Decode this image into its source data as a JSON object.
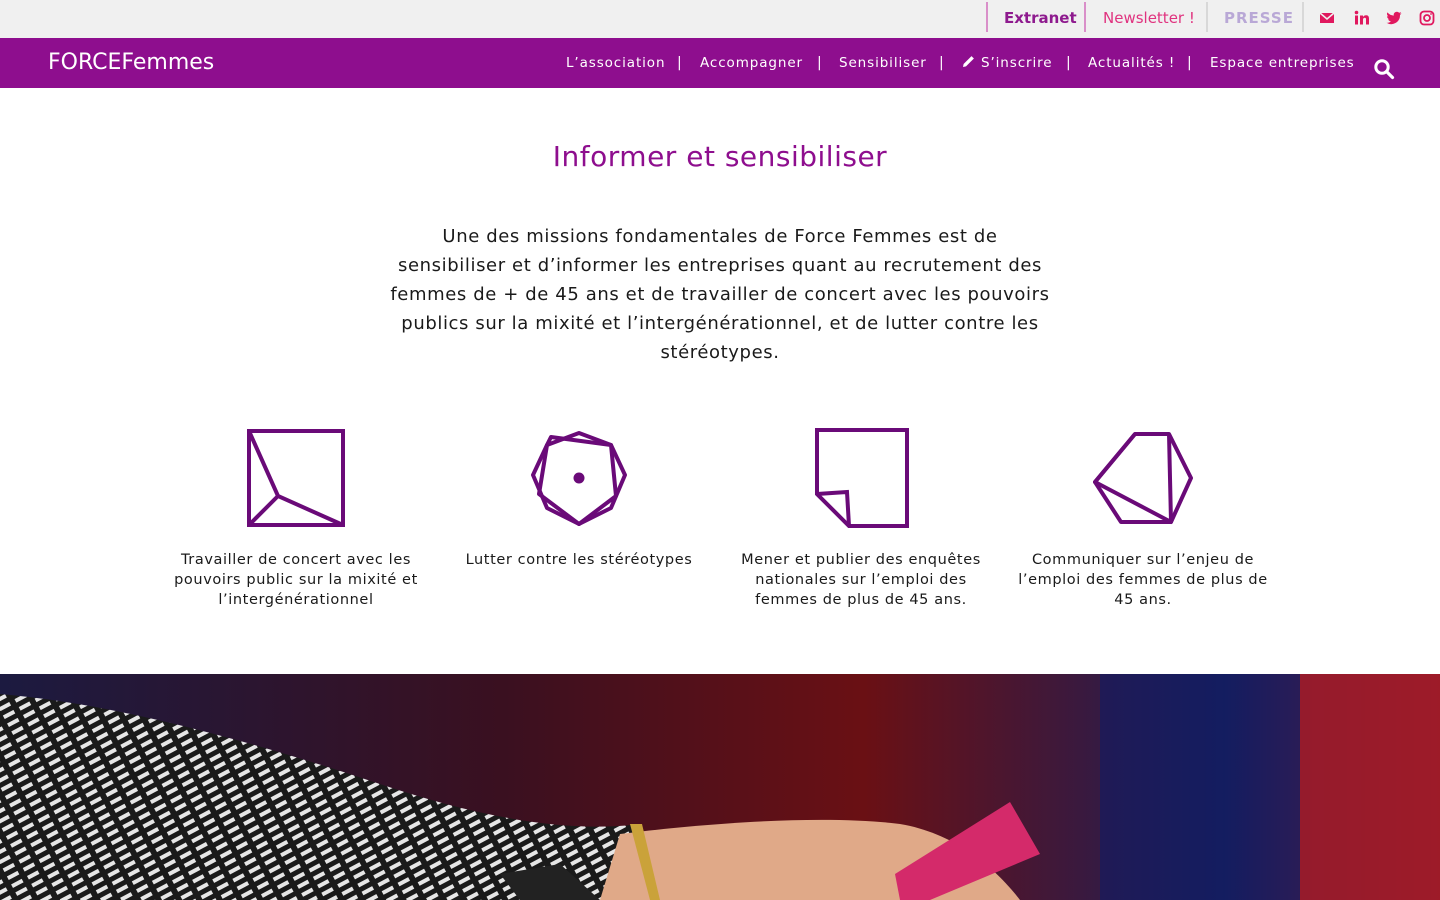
{
  "topbar": {
    "extranet": "Extranet",
    "newsletter": "Newsletter !",
    "presse": "PRESSE",
    "social_icons": [
      "envelope-icon",
      "linkedin-icon",
      "twitter-icon",
      "instagram-icon"
    ],
    "social_color": "#e0185e"
  },
  "header": {
    "logo": "FORCEFemmes",
    "nav": [
      {
        "label": "L’association"
      },
      {
        "label": "Accompagner"
      },
      {
        "label": "Sensibiliser"
      },
      {
        "label": "S’inscrire",
        "icon": "pencil-icon"
      },
      {
        "label": "Actualités !"
      },
      {
        "label": "Espace entreprises"
      }
    ],
    "separator": "|",
    "search_icon": "search-icon"
  },
  "main": {
    "title": "Informer et sensibiliser",
    "intro": "Une des missions fondamentales de Force Femmes est de sensibiliser et d’informer les entreprises quant au recrutement des femmes de + de 45 ans et de travailler de concert avec les pouvoirs publics sur la mixité et l’intergénérationnel, et de lutter contre les stéréotypes.",
    "features": [
      {
        "icon": "square-geometric-icon",
        "caption": "Travailler de concert avec les pouvoirs public sur la mixité et l’intergénérationnel"
      },
      {
        "icon": "heptagon-geometric-icon",
        "caption": "Lutter contre les stéréotypes"
      },
      {
        "icon": "folded-square-icon",
        "caption": "Mener et publier des enquêtes nationales sur l’emploi des femmes de plus de 45 ans."
      },
      {
        "icon": "hexagon-geometric-icon",
        "caption": "Communiquer sur l’enjeu de l’emploi des femmes de plus de 45 ans."
      }
    ]
  },
  "colors": {
    "brand_purple": "#8e0e8e",
    "icon_purple": "#6a0a78",
    "newsletter_pink": "#e0337f"
  }
}
